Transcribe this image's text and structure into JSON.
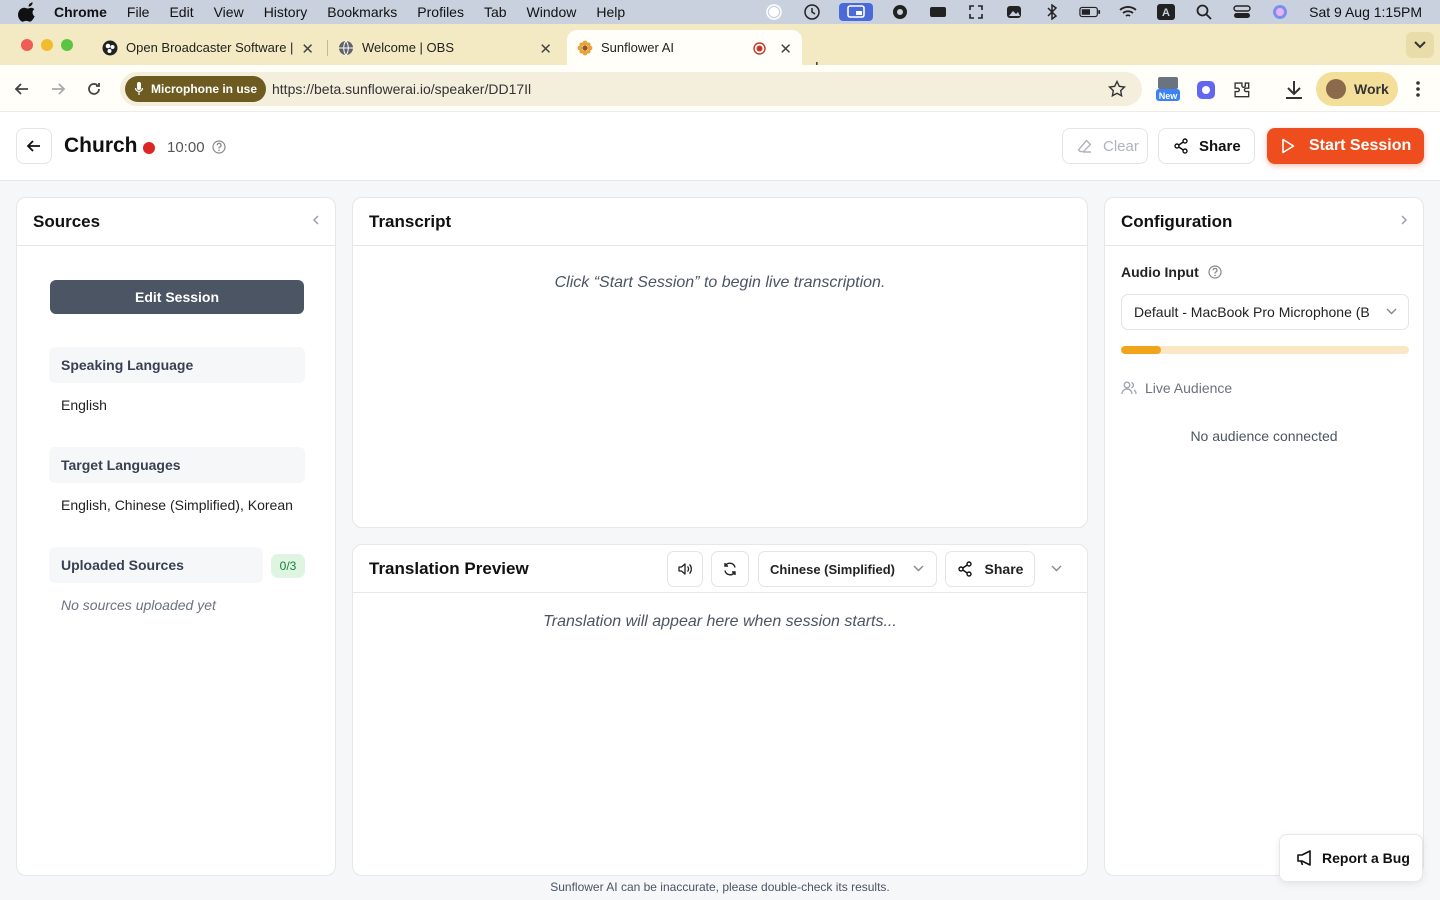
{
  "menubar": {
    "app": "Chrome",
    "items": [
      "File",
      "Edit",
      "View",
      "History",
      "Bookmarks",
      "Profiles",
      "Tab",
      "Window",
      "Help"
    ],
    "clock": "Sat 9 Aug  1:15PM"
  },
  "tabs": [
    {
      "label": "Open Broadcaster Software |"
    },
    {
      "label": "Welcome | OBS"
    },
    {
      "label": "Sunflower AI"
    }
  ],
  "addressbar": {
    "mic_pill": "Microphone in use",
    "url": "https://beta.sunflowerai.io/speaker/DD17Il",
    "profile": "Work",
    "ext_badge": "New"
  },
  "header": {
    "title": "Church",
    "timer": "10:00",
    "clear_label": "Clear",
    "share_label": "Share",
    "start_label": "Start Session"
  },
  "sources": {
    "title": "Sources",
    "edit_label": "Edit Session",
    "speaking_label": "Speaking Language",
    "speaking_value": "English",
    "target_label": "Target Languages",
    "target_value": "English, Chinese (Simplified), Korean",
    "uploaded_label": "Uploaded Sources",
    "uploaded_count": "0/3",
    "uploaded_empty": "No sources uploaded yet"
  },
  "transcript": {
    "title": "Transcript",
    "empty": "Click “Start Session” to begin live transcription."
  },
  "translation": {
    "title": "Translation Preview",
    "language": "Chinese (Simplified)",
    "share_label": "Share",
    "empty": "Translation will appear here when session starts..."
  },
  "config": {
    "title": "Configuration",
    "audio_label": "Audio Input",
    "audio_value": "Default - MacBook Pro Microphone (B",
    "audio_level": 0.14,
    "live_label": "Live Audience",
    "no_audience": "No audience connected"
  },
  "bug_label": "Report a Bug",
  "footer": "Sunflower AI can be inaccurate, please double-check its results.",
  "colors": {
    "accent": "#ee4d1d",
    "rec": "#dc2626",
    "meter": "#f2a51c"
  }
}
